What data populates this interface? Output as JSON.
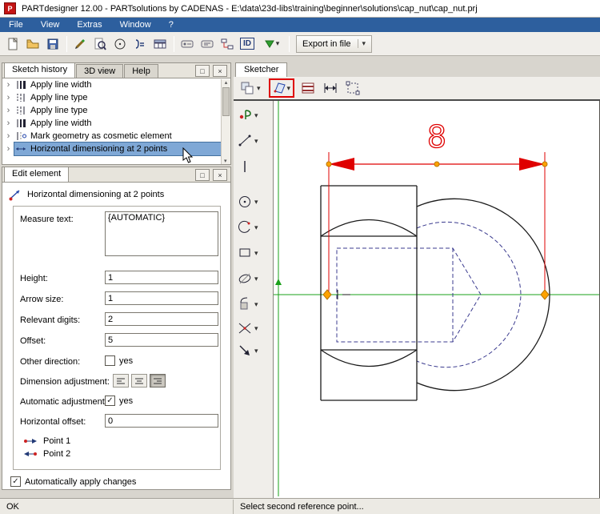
{
  "icons": {
    "dropdown": "▾",
    "dropup": "▴",
    "close": "×",
    "restore": "□",
    "check": "✓",
    "chevron": "›"
  },
  "window": {
    "logo": "P",
    "title": "PARTdesigner 12.00 - PARTsolutions by CADENAS - E:\\data\\23d-libs\\training\\beginner\\solutions\\cap_nut\\cap_nut.prj",
    "menu": [
      "File",
      "View",
      "Extras",
      "Window",
      "?"
    ]
  },
  "toolbar": {
    "id_label": "ID",
    "export_label": "Export in file"
  },
  "sketch_history": {
    "tabs": [
      "Sketch history",
      "3D view",
      "Help"
    ],
    "items": [
      "Apply line width",
      "Apply line type",
      "Apply line type",
      "Apply line width",
      "Mark geometry as cosmetic element",
      "Horizontal dimensioning at 2 points"
    ],
    "selected_index": 5
  },
  "edit_element": {
    "tab": "Edit element",
    "title": "Horizontal dimensioning at 2 points",
    "measure_text": {
      "label": "Measure text:",
      "value": "{AUTOMATIC}"
    },
    "height": {
      "label": "Height:",
      "value": "1"
    },
    "arrow_size": {
      "label": "Arrow size:",
      "value": "1"
    },
    "relevant_digits": {
      "label": "Relevant digits:",
      "value": "2"
    },
    "offset": {
      "label": "Offset:",
      "value": "5"
    },
    "other_direction": {
      "label": "Other direction:",
      "option": "yes",
      "checked": false
    },
    "dimension_adjustment": {
      "label": "Dimension adjustment:",
      "selected": "right"
    },
    "automatic_adjustment": {
      "label": "Automatic adjustment:",
      "option": "yes",
      "checked": true
    },
    "horizontal_offset": {
      "label": "Horizontal offset:",
      "value": "0"
    },
    "point1": "Point 1",
    "point2": "Point 2",
    "apply_changes": "Automatically apply changes",
    "apply_changes_checked": true
  },
  "sketcher": {
    "tab": "Sketcher",
    "dimension_value": "8",
    "status": "Select second reference point..."
  },
  "status_left": "OK",
  "colors": {
    "menubar": "#2d5f9e",
    "selection": "#7fa8d6",
    "dimension_red": "#df0000",
    "handle_orange": "#ffa200",
    "axis_green": "#1aa01a",
    "hidden_line_blue": "#3b3b8f"
  }
}
